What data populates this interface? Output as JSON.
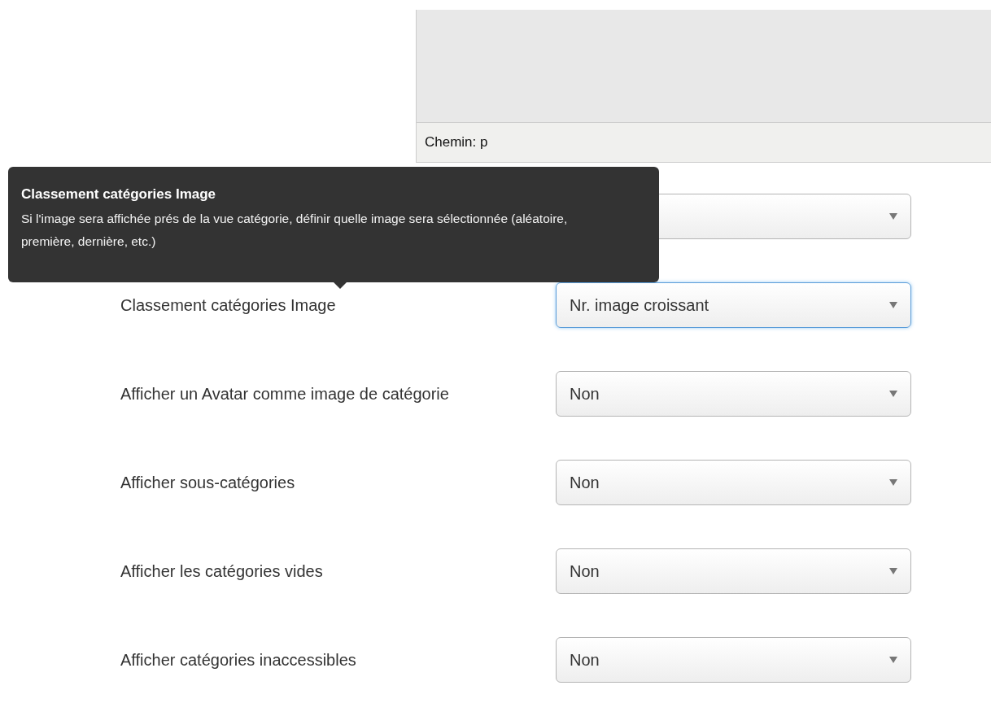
{
  "editor": {
    "path_label": "Chemin: p"
  },
  "tooltip": {
    "title": "Classement catégories Image",
    "text": "Si l'image sera affichée prés de la vue catégorie, définir quelle image sera sélectionnée (aléatoire, première, dernière, etc.)"
  },
  "settings": [
    {
      "focused": false
    },
    {
      "label": "Classement catégories Image",
      "value": "Nr. image croissant",
      "focused": true
    },
    {
      "label": "Afficher un Avatar comme image de catégorie",
      "value": "Non",
      "focused": false
    },
    {
      "label": "Afficher sous-catégories",
      "value": "Non",
      "focused": false
    },
    {
      "label": "Afficher les catégories vides",
      "value": "Non",
      "focused": false
    },
    {
      "label": "Afficher catégories inaccessibles",
      "value": "Non",
      "focused": false
    }
  ]
}
